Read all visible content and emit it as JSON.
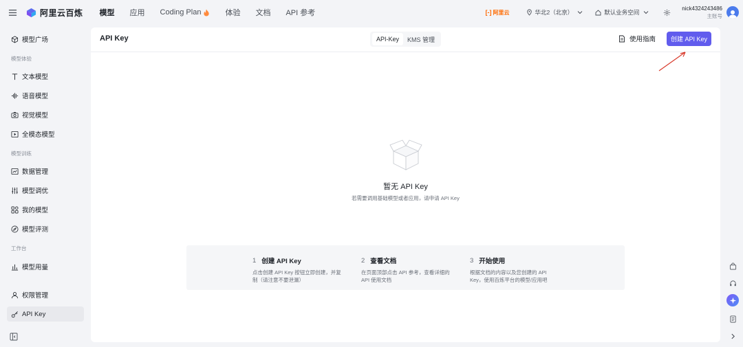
{
  "header": {
    "brand": "阿里云百炼",
    "nav": [
      {
        "label": "模型",
        "active": true
      },
      {
        "label": "应用"
      },
      {
        "label": "Coding Plan"
      },
      {
        "label": "体验"
      },
      {
        "label": "文档"
      },
      {
        "label": "API 参考"
      }
    ],
    "aliyun_label": "阿里云",
    "region": "华北2（北京）",
    "workspace": "默认业务空间",
    "user_name": "nick4324243486",
    "user_role": "主账号"
  },
  "sidebar": {
    "items": [
      {
        "label": "模型广场",
        "icon": "cube-icon"
      },
      {
        "group": "模型体验"
      },
      {
        "label": "文本模型",
        "icon": "text-icon"
      },
      {
        "label": "语音模型",
        "icon": "audio-icon"
      },
      {
        "label": "视觉模型",
        "icon": "camera-icon"
      },
      {
        "label": "全模态模型",
        "icon": "play-icon"
      },
      {
        "group": "模型训练"
      },
      {
        "label": "数据管理",
        "icon": "chart-icon"
      },
      {
        "label": "模型调优",
        "icon": "sliders-icon"
      },
      {
        "label": "我的模型",
        "icon": "grid-icon"
      },
      {
        "label": "模型评测",
        "icon": "compass-icon"
      },
      {
        "group": "工作台"
      },
      {
        "label": "模型用量",
        "icon": "bar-chart-icon"
      },
      {
        "label": "权限管理",
        "icon": "user-icon"
      },
      {
        "label": "API Key",
        "icon": "key-icon",
        "active": true
      }
    ]
  },
  "main": {
    "title": "API Key",
    "tabs": [
      {
        "label": "API-Key",
        "active": true
      },
      {
        "label": "KMS 管理"
      }
    ],
    "guide_label": "使用指南",
    "create_label": "创建 API Key",
    "empty_title": "暂无 API Key",
    "empty_subtitle": "若需要调用基础模型或者应用，请申请 API Key",
    "steps": [
      {
        "num": "1",
        "title": "创建 API Key",
        "desc": "点击创建 API Key 按钮立即创建，并复制（请注意不要泄漏）"
      },
      {
        "num": "2",
        "title": "查看文档",
        "desc": "在页面顶部点击 API 参考，查看详细的 API 使用文档"
      },
      {
        "num": "3",
        "title": "开始使用",
        "desc": "根据文档的内容以及您创建的 API Key，使用百炼平台的模型/应用吧"
      }
    ]
  },
  "colors": {
    "accent": "#615ced",
    "aliyun_orange": "#ff6a00",
    "annotation_arrow": "#d93a2b"
  }
}
